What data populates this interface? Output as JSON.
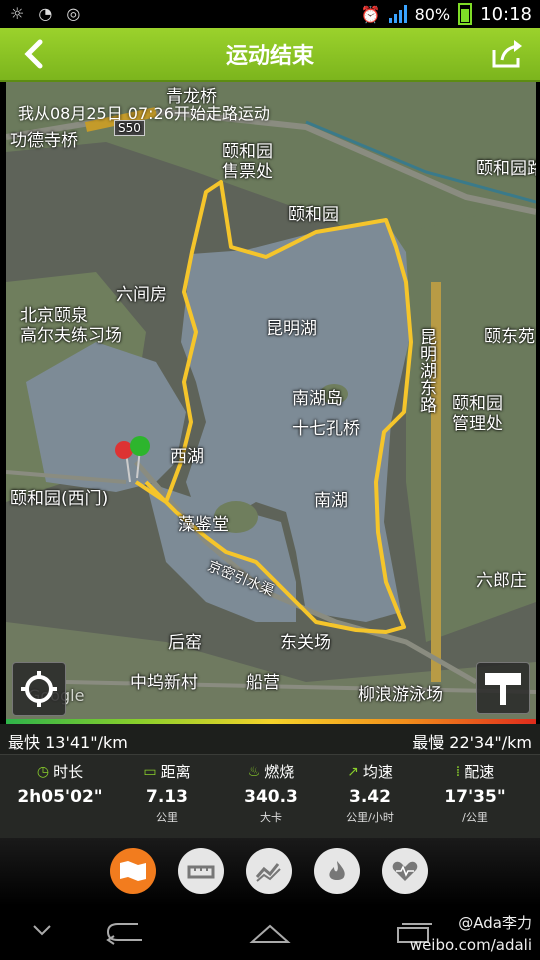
{
  "status_bar": {
    "battery": "80%",
    "time": "10:18"
  },
  "header": {
    "title": "运动结束"
  },
  "map": {
    "info_text": "我从08月25日 07:26开始走路运动",
    "labels": {
      "qinglongqiao": "青龙桥",
      "gongdesi": "功德寺桥",
      "s50": "S50",
      "ticket": "颐和园\n售票处",
      "summer_palace": "颐和园",
      "summer_palace_right": "颐和园路",
      "liujianfang": "六间房",
      "golf": "北京颐泉\n高尔夫练习场",
      "kunming": "昆明湖",
      "yidong": "颐东苑",
      "kunming_road": "昆明湖东路",
      "nanhudao": "南湖岛",
      "seventeen": "十七孔桥",
      "admin": "颐和园\n管理处",
      "xihu": "西湖",
      "west_gate": "颐和园(西门)",
      "nanhu": "南湖",
      "zaojiantang": "藻鉴堂",
      "canal": "京密引水渠",
      "liulangzhuang": "六郎庄",
      "houying": "后窑",
      "dongguanchang": "东关场",
      "zhongwu": "中坞新村",
      "chuanying": "船营",
      "liulang_swim": "柳浪游泳场",
      "google": "Google"
    }
  },
  "speed": {
    "fastest": "最快 13'41\"/km",
    "slowest": "最慢 22'34\"/km"
  },
  "stats": [
    {
      "label": "时长",
      "value": "2h05'02\"",
      "unit": ""
    },
    {
      "label": "距离",
      "value": "7.13",
      "unit": "公里"
    },
    {
      "label": "燃烧",
      "value": "340.3",
      "unit": "大卡"
    },
    {
      "label": "均速",
      "value": "3.42",
      "unit": "公里/小时"
    },
    {
      "label": "配速",
      "value": "17'35\"",
      "unit": "/公里"
    }
  ],
  "watermark": {
    "line1": "@Ada李力",
    "line2": "weibo.com/adali"
  },
  "colors": {
    "accent": "#8acf2b",
    "route": "#f5c52b",
    "active_tab": "#f27c1e"
  }
}
